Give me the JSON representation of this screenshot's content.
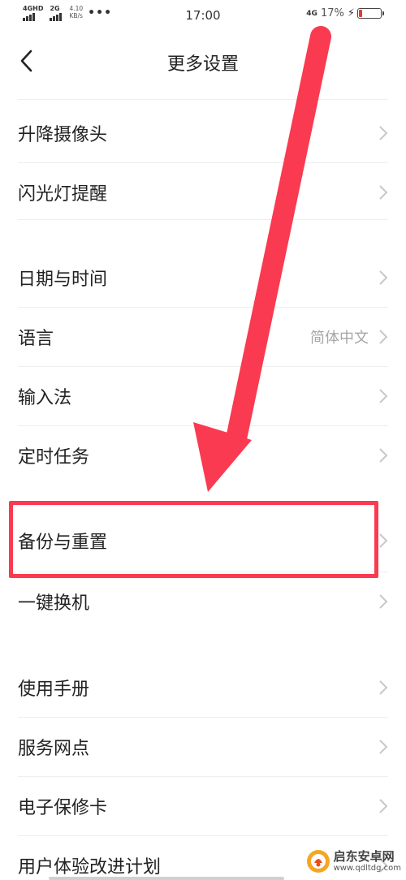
{
  "status_bar": {
    "network_1": "4GHD",
    "network_2": "2G",
    "speed_value": "4.10",
    "speed_unit": "KB/s",
    "more": "•••",
    "time": "17:00",
    "net_right": "4G",
    "battery": "17%",
    "battery_level_percent": 17
  },
  "header": {
    "title": "更多设置"
  },
  "rows": [
    {
      "label": "升降摄像头",
      "value": ""
    },
    {
      "label": "闪光灯提醒",
      "value": ""
    },
    {
      "label": "日期与时间",
      "value": ""
    },
    {
      "label": "语言",
      "value": "简体中文"
    },
    {
      "label": "输入法",
      "value": ""
    },
    {
      "label": "定时任务",
      "value": ""
    },
    {
      "label": "备份与重置",
      "value": ""
    },
    {
      "label": "一键换机",
      "value": ""
    },
    {
      "label": "使用手册",
      "value": ""
    },
    {
      "label": "服务网点",
      "value": ""
    },
    {
      "label": "电子保修卡",
      "value": ""
    },
    {
      "label": "用户体验改进计划",
      "value": ""
    }
  ],
  "watermark": {
    "name": "启东安卓网",
    "url": "www.qdltdg.com"
  },
  "colors": {
    "annotation_red": "#fa3a50",
    "chevron": "#c8c8c8",
    "secondary_text": "#a6a6a6"
  },
  "icons": {
    "back": "back-arrow-icon",
    "chevron": "chevron-right-icon",
    "battery": "battery-icon",
    "charging": "charging-bolt-icon"
  }
}
